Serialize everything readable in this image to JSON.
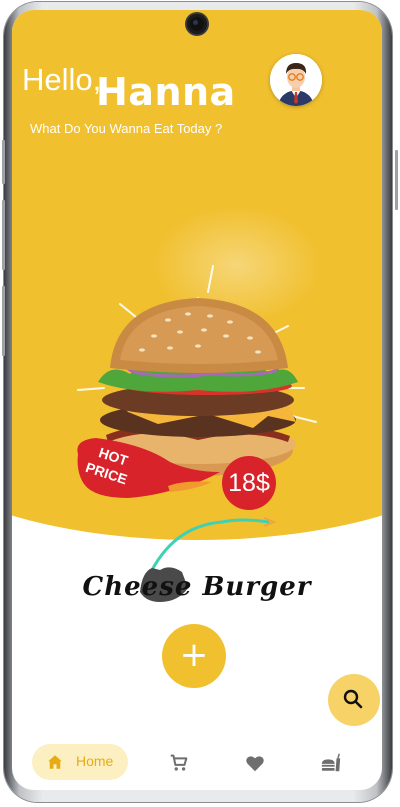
{
  "greeting": {
    "hello": "Hello,",
    "name": "Hanna",
    "subtitle": "What Do You Wanna Eat Today ?"
  },
  "promo": {
    "tag_line1": "HOT",
    "tag_line2": "PRICE",
    "price": "18$"
  },
  "product": {
    "name": "Cheese Burger"
  },
  "actions": {
    "add_label": "+"
  },
  "nav": {
    "items": [
      {
        "label": "Home",
        "icon": "home-icon",
        "active": true
      },
      {
        "label": "",
        "icon": "cart-icon"
      },
      {
        "label": "",
        "icon": "heart-icon"
      },
      {
        "label": "",
        "icon": "fastfood-icon"
      }
    ]
  },
  "colors": {
    "primary": "#f1c02f",
    "accent_light": "#fcefc2",
    "price_red": "#d9232a",
    "icon_grey": "#6e6e6e",
    "home_label": "#e7ab14"
  }
}
